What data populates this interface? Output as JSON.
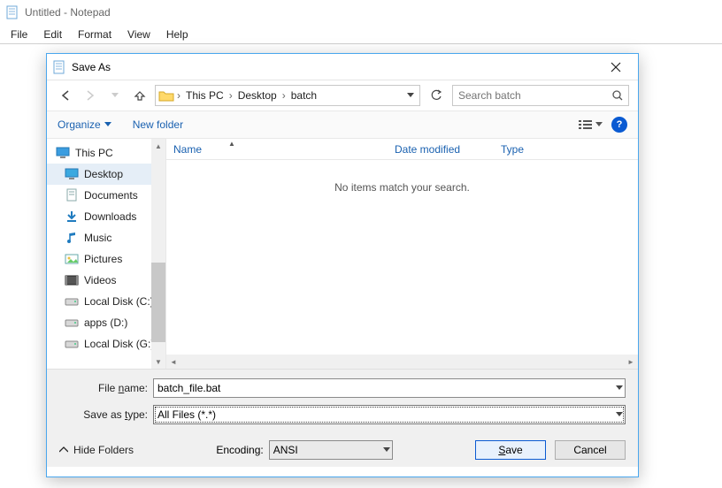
{
  "notepad": {
    "title": "Untitled - Notepad",
    "menu": {
      "file": "File",
      "edit": "Edit",
      "format": "Format",
      "view": "View",
      "help": "Help"
    }
  },
  "dialog": {
    "title": "Save As",
    "breadcrumb": [
      "This PC",
      "Desktop",
      "batch"
    ],
    "search_placeholder": "Search batch",
    "toolbar": {
      "organize": "Organize",
      "newfolder": "New folder"
    },
    "tree": [
      {
        "key": "thispc",
        "label": "This PC",
        "icon": "monitor",
        "sub": false,
        "selected": false
      },
      {
        "key": "desktop",
        "label": "Desktop",
        "icon": "desktop",
        "sub": true,
        "selected": true
      },
      {
        "key": "documents",
        "label": "Documents",
        "icon": "documents",
        "sub": true,
        "selected": false
      },
      {
        "key": "downloads",
        "label": "Downloads",
        "icon": "download",
        "sub": true,
        "selected": false
      },
      {
        "key": "music",
        "label": "Music",
        "icon": "music",
        "sub": true,
        "selected": false
      },
      {
        "key": "pictures",
        "label": "Pictures",
        "icon": "pictures",
        "sub": true,
        "selected": false
      },
      {
        "key": "videos",
        "label": "Videos",
        "icon": "videos",
        "sub": true,
        "selected": false
      },
      {
        "key": "localc",
        "label": "Local Disk (C:)",
        "icon": "disk",
        "sub": true,
        "selected": false
      },
      {
        "key": "appsd",
        "label": "apps (D:)",
        "icon": "disk",
        "sub": true,
        "selected": false
      },
      {
        "key": "localg",
        "label": "Local Disk (G:)",
        "icon": "disk",
        "sub": true,
        "selected": false
      }
    ],
    "columns": {
      "name": "Name",
      "date": "Date modified",
      "type": "Type"
    },
    "empty_msg": "No items match your search.",
    "filename_label": "File name:",
    "filename_value": "batch_file.bat",
    "savetype_label": "Save as type:",
    "savetype_value": "All Files  (*.*)",
    "hide_folders": "Hide Folders",
    "encoding_label": "Encoding:",
    "encoding_value": "ANSI",
    "save_btn": "Save",
    "cancel_btn": "Cancel"
  }
}
